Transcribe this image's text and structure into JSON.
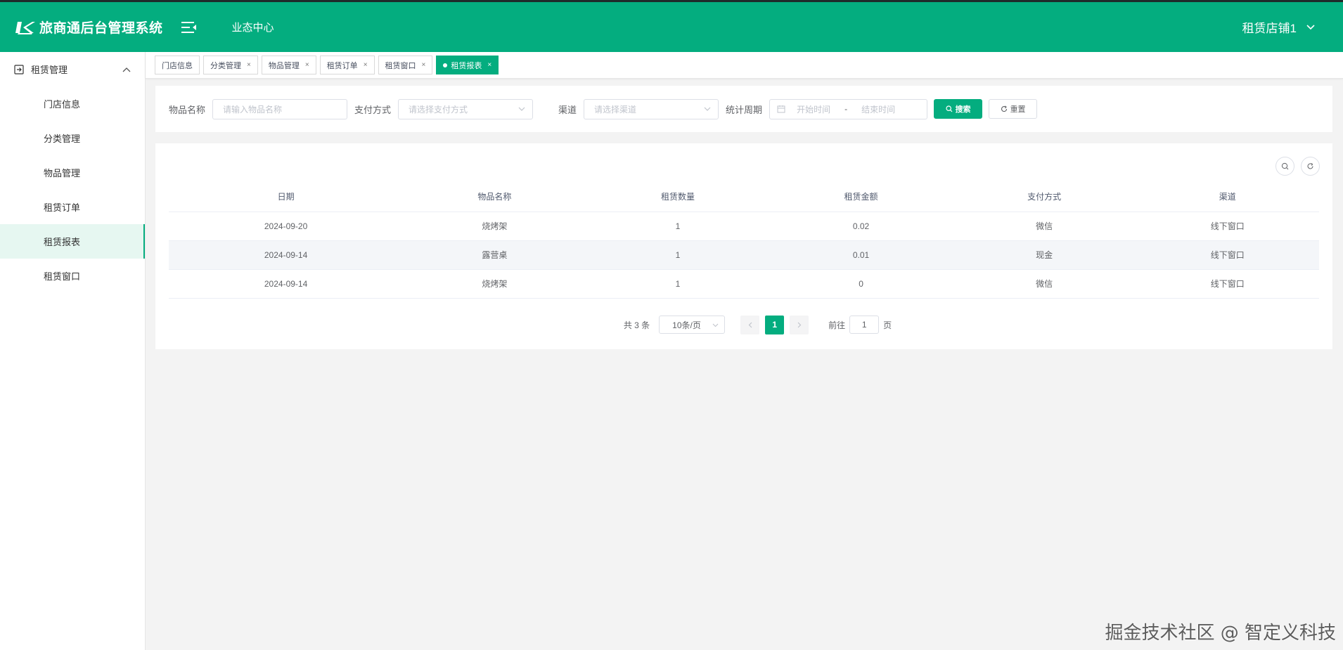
{
  "header": {
    "app_title": "旅商通后台管理系统",
    "nav_label": "业态中心",
    "user_label": "租赁店铺1"
  },
  "sidebar": {
    "group_label": "租赁管理",
    "items": [
      {
        "label": "门店信息"
      },
      {
        "label": "分类管理"
      },
      {
        "label": "物品管理"
      },
      {
        "label": "租赁订单"
      },
      {
        "label": "租赁报表",
        "active": true
      },
      {
        "label": "租赁窗口"
      }
    ]
  },
  "tabs": [
    {
      "label": "门店信息",
      "closable": false
    },
    {
      "label": "分类管理",
      "closable": true
    },
    {
      "label": "物品管理",
      "closable": true
    },
    {
      "label": "租赁订单",
      "closable": true
    },
    {
      "label": "租赁窗口",
      "closable": true
    },
    {
      "label": "租赁报表",
      "closable": true,
      "active": true
    }
  ],
  "search": {
    "item_name_label": "物品名称",
    "item_name_placeholder": "请输入物品名称",
    "payment_label": "支付方式",
    "payment_placeholder": "请选择支付方式",
    "channel_label": "渠道",
    "channel_placeholder": "请选择渠道",
    "period_label": "统计周期",
    "start_placeholder": "开始时间",
    "range_separator": "-",
    "end_placeholder": "结束时间",
    "search_button": "搜索",
    "reset_button": "重置"
  },
  "table": {
    "columns": [
      "日期",
      "物品名称",
      "租赁数量",
      "租赁金额",
      "支付方式",
      "渠道"
    ],
    "rows": [
      [
        "2024-09-20",
        "烧烤架",
        "1",
        "0.02",
        "微信",
        "线下窗口"
      ],
      [
        "2024-09-14",
        "露营桌",
        "1",
        "0.01",
        "现金",
        "线下窗口"
      ],
      [
        "2024-09-14",
        "烧烤架",
        "1",
        "0",
        "微信",
        "线下窗口"
      ]
    ]
  },
  "pagination": {
    "total_text": "共 3 条",
    "page_size": "10条/页",
    "current_page": "1",
    "goto_prefix": "前往",
    "goto_value": "1",
    "goto_suffix": "页"
  },
  "watermark": "掘金技术社区 @ 智定义科技",
  "colors": {
    "brand": "#04ad7f",
    "active_menu_bg": "#e6f7f1"
  }
}
